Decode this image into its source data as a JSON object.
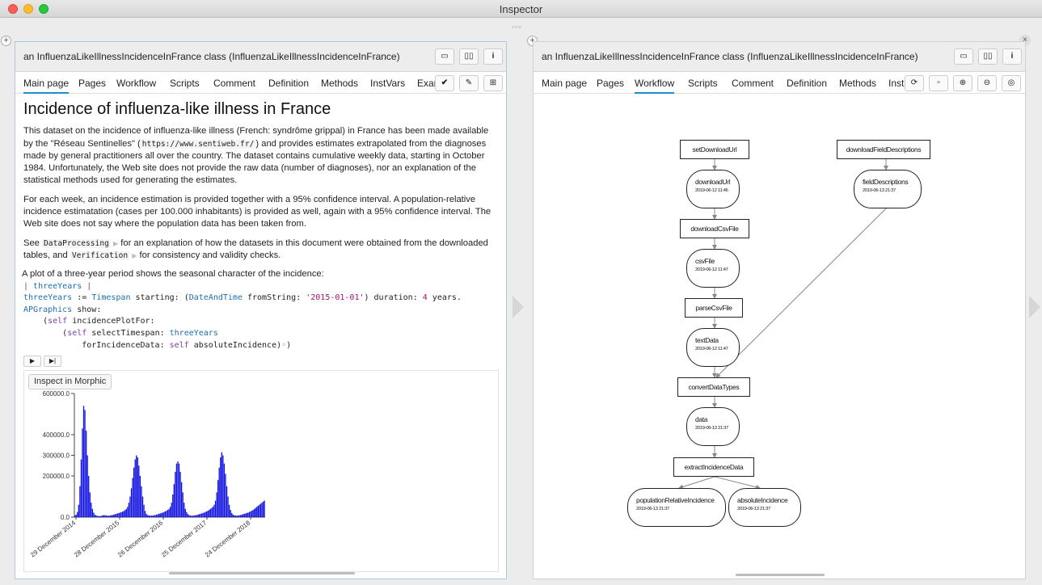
{
  "window": {
    "title": "Inspector"
  },
  "left": {
    "title": "an InfluenzaLikeIllnessIncidenceInFrance class (InfluenzaLikeIllnessIncidenceInFrance)",
    "tabs": [
      "Main page",
      "Pages",
      "Workflow",
      "Scripts",
      "Comment",
      "Definition",
      "Methods",
      "InstVars",
      "Exar"
    ],
    "doc": {
      "heading": "Incidence of influenza-like illness in France",
      "p1": "This dataset on the incidence of influenza-like illness (French: syndrôme grippal) in France has been made available by the \"Réseau Sentinelles\" (",
      "p1_url": "https://www.sentiweb.fr/",
      "p1_rest": ") and provides estimates extrapolated from the diagnoses made by general practitioners all over the country. The dataset contains cumulative weekly data, starting in October 1984. Unfortunately, the Web site does not provide the raw data (number of diagnoses), nor an explanation of the statistical methods used for generating the estimates.",
      "p2": "For each week, an  incidence estimation is provided together with a 95% confidence interval. A population-relative incidence estimatation (cases per 100.000 inhabitants) is provided as well, again with a 95% confidence interval. The Web site does not say where the population data has been taken from.",
      "p3_see": "See",
      "p3_link1": "DataProcessing",
      "p3_mid": "for an explanation of how the datasets in this document were obtained from the downloaded tables, and",
      "p3_link2": "Verification",
      "p3_end": "for consistency and validity checks.",
      "p4": "A plot of a three-year period shows the seasonal character of the incidence:"
    },
    "inspect_button": "Inspect in Morphic"
  },
  "right": {
    "title": "an InfluenzaLikeIllnessIncidenceInFrance class (InfluenzaLikeIllnessIncidenceInFrance)",
    "tabs": [
      "Main page",
      "Pages",
      "Workflow",
      "Scripts",
      "Comment",
      "Definition",
      "Methods",
      "Inst"
    ],
    "nodes": {
      "setDownloadUrl": "setDownloadUrl",
      "downloadUrl": "downloadUrl",
      "downloadUrl_ts": "2019-06-12 11:46",
      "downloadCsvFile": "downloadCsvFile",
      "csvFile": "csvFile",
      "csvFile_ts": "2019-06-12 11:47",
      "parseCsvFile": "parseCsvFile",
      "textData": "textData",
      "textData_ts": "2019-06-12 11:47",
      "convertDataTypes": "convertDataTypes",
      "data": "data",
      "data_ts": "2019-06-13 21:37",
      "extractIncidenceData": "extractIncidenceData",
      "populationRelativeIncidence": "populationRelativeIncidence",
      "populationRelativeIncidence_ts": "2019-06-13 21:37",
      "absoluteIncidence": "absoluteIncidence",
      "absoluteIncidence_ts": "2019-06-13 21:37",
      "downloadFieldDescriptions": "downloadFieldDescriptions",
      "fieldDescriptions": "fieldDescriptions",
      "fieldDescriptions_ts": "2019-06-13 21:37"
    }
  },
  "colors": {
    "accent": "#1d8fd0",
    "bars": "#1515e0"
  },
  "chart_data": {
    "type": "bar",
    "ylabel": "",
    "yticks": [
      "600000.0",
      "400000.0",
      "300000.0",
      "200000.0",
      "0.0"
    ],
    "ytick_values": [
      600000,
      400000,
      300000,
      200000,
      0
    ],
    "ylim": [
      0,
      600000
    ],
    "xtick_labels": [
      "29 December 2014",
      "28 December 2015",
      "26 December 2016",
      "25 December 2017",
      "24 December 2018"
    ],
    "series": [
      {
        "values": [
          8000,
          12000,
          25000,
          60000,
          150000,
          280000,
          430000,
          540000,
          520000,
          420000,
          300000,
          200000,
          120000,
          70000,
          40000,
          22000,
          12000,
          8000,
          6000,
          5000,
          5000,
          6000,
          8000,
          10000,
          9000,
          8000,
          7000,
          7000,
          8000,
          9000,
          10000,
          12000,
          14000,
          16000,
          18000,
          20000,
          22000,
          24000,
          27000,
          30000,
          34000,
          40000,
          50000,
          70000,
          100000,
          140000,
          190000,
          240000,
          280000,
          300000,
          290000,
          250000,
          200000,
          150000,
          100000,
          60000,
          30000,
          15000,
          10000,
          8000,
          7000,
          7000,
          8000,
          9000,
          10000,
          12000,
          14000,
          16000,
          18000,
          20000,
          22000,
          25000,
          28000,
          31000,
          35000,
          40000,
          50000,
          70000,
          110000,
          160000,
          220000,
          260000,
          270000,
          260000,
          220000,
          170000,
          120000,
          70000,
          40000,
          25000,
          15000,
          10000,
          8000,
          7000,
          7000,
          8000,
          9000,
          10000,
          12000,
          14000,
          16000,
          18000,
          20000,
          22000,
          25000,
          28000,
          31000,
          35000,
          40000,
          45000,
          50000,
          60000,
          80000,
          120000,
          180000,
          240000,
          290000,
          315000,
          300000,
          260000,
          210000,
          150000,
          100000,
          60000,
          35000,
          20000,
          12000,
          9000,
          8000,
          7000,
          8000,
          9000,
          10000,
          12000,
          14000,
          16000,
          18000,
          20000,
          22000,
          25000,
          28000,
          31000,
          35000,
          40000,
          45000,
          50000,
          55000,
          60000,
          65000,
          70000,
          75000,
          80000
        ]
      }
    ]
  }
}
